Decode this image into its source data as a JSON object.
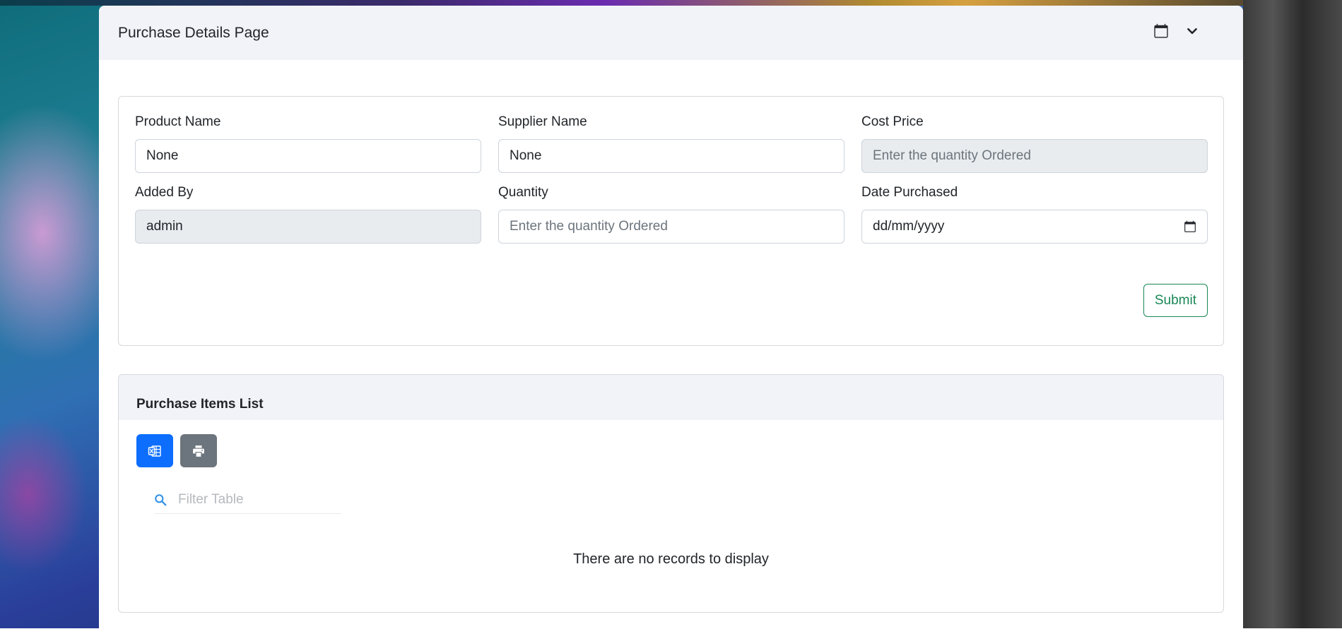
{
  "header": {
    "title": "Purchase Details Page",
    "calendar_icon": "calendar-icon",
    "dropdown_icon": "chevron-down-icon"
  },
  "form": {
    "product_name": {
      "label": "Product Name",
      "value": "None"
    },
    "supplier_name": {
      "label": "Supplier Name",
      "value": "None"
    },
    "cost_price": {
      "label": "Cost Price",
      "placeholder": "Enter the quantity Ordered"
    },
    "added_by": {
      "label": "Added By",
      "value": "admin"
    },
    "quantity": {
      "label": "Quantity",
      "placeholder": "Enter the quantity Ordered"
    },
    "date_purchased": {
      "label": "Date Purchased",
      "value": "dd/mm/yyyy"
    },
    "submit_label": "Submit"
  },
  "list": {
    "title": "Purchase Items List",
    "export_excel_icon": "excel-icon",
    "print_icon": "print-icon",
    "filter_placeholder": "Filter Table",
    "empty_message": "There are no records to display"
  },
  "colors": {
    "primary": "#0d6efd",
    "secondary": "#6c757d",
    "success": "#198754",
    "header_bg": "#f2f3f8"
  }
}
